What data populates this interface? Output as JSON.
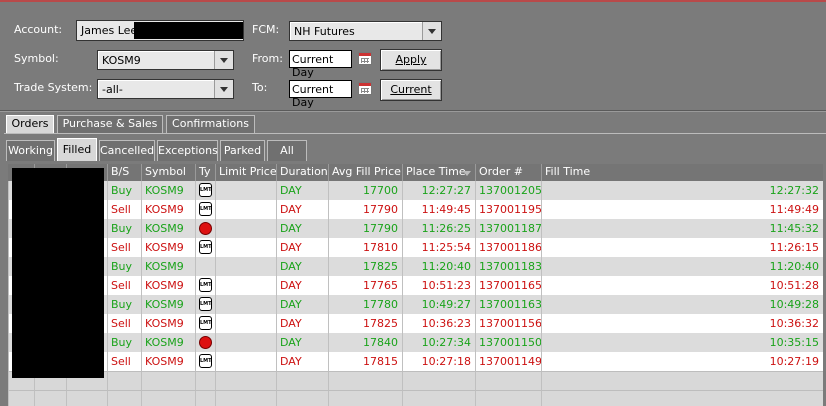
{
  "form": {
    "account_label": "Account:",
    "account_value": "James Lee",
    "fcm_label": "FCM:",
    "fcm_value": "NH Futures",
    "symbol_label": "Symbol:",
    "symbol_value": "KOSM9",
    "from_label": "From:",
    "from_value": "Current Day",
    "apply_label": "Apply",
    "trade_system_label": "Trade System:",
    "trade_system_value": "-all-",
    "to_label": "To:",
    "to_value": "Current Day",
    "current_label": "Current"
  },
  "main_tabs": [
    {
      "label": "Orders",
      "active": true
    },
    {
      "label": "Purchase & Sales",
      "active": false
    },
    {
      "label": "Confirmations",
      "active": false
    }
  ],
  "sub_tabs": [
    {
      "label": "Working",
      "active": false
    },
    {
      "label": "Filled",
      "active": true
    },
    {
      "label": "Cancelled",
      "active": false
    },
    {
      "label": "Exceptions",
      "active": false
    },
    {
      "label": "Parked",
      "active": false
    },
    {
      "label": "All",
      "active": false
    }
  ],
  "columns": {
    "bs": "B/S",
    "symbol": "Symbol",
    "type": "Ty",
    "limit_price": "Limit Price",
    "duration": "Duration",
    "avg_fill": "Avg Fill Price",
    "place_time": "Place Time",
    "order_no": "Order #",
    "fill_time": "Fill Time"
  },
  "rows": [
    {
      "side": "Buy",
      "symbol": "KOSM9",
      "type": "limit",
      "duration": "DAY",
      "avg_fill": "17700",
      "place_time": "12:27:27",
      "order_no": "137001205",
      "fill_time": "12:27:32"
    },
    {
      "side": "Sell",
      "symbol": "KOSM9",
      "type": "limit",
      "duration": "DAY",
      "avg_fill": "17790",
      "place_time": "11:49:45",
      "order_no": "137001195",
      "fill_time": "11:49:49"
    },
    {
      "side": "Buy",
      "symbol": "KOSM9",
      "type": "stop",
      "duration": "DAY",
      "avg_fill": "17790",
      "place_time": "11:26:25",
      "order_no": "137001187",
      "fill_time": "11:45:32"
    },
    {
      "side": "Sell",
      "symbol": "KOSM9",
      "type": "limit",
      "duration": "DAY",
      "avg_fill": "17810",
      "place_time": "11:25:54",
      "order_no": "137001186",
      "fill_time": "11:26:15"
    },
    {
      "side": "Buy",
      "symbol": "KOSM9",
      "type": "none",
      "duration": "DAY",
      "avg_fill": "17825",
      "place_time": "11:20:40",
      "order_no": "137001183",
      "fill_time": "11:20:40"
    },
    {
      "side": "Sell",
      "symbol": "KOSM9",
      "type": "limit",
      "duration": "DAY",
      "avg_fill": "17765",
      "place_time": "10:51:23",
      "order_no": "137001165",
      "fill_time": "10:51:28"
    },
    {
      "side": "Buy",
      "symbol": "KOSM9",
      "type": "limit",
      "duration": "DAY",
      "avg_fill": "17780",
      "place_time": "10:49:27",
      "order_no": "137001163",
      "fill_time": "10:49:28"
    },
    {
      "side": "Sell",
      "symbol": "KOSM9",
      "type": "limit",
      "duration": "DAY",
      "avg_fill": "17825",
      "place_time": "10:36:23",
      "order_no": "137001156",
      "fill_time": "10:36:32"
    },
    {
      "side": "Buy",
      "symbol": "KOSM9",
      "type": "stop",
      "duration": "DAY",
      "avg_fill": "17840",
      "place_time": "10:27:34",
      "order_no": "137001150",
      "fill_time": "10:35:15"
    },
    {
      "side": "Sell",
      "symbol": "KOSM9",
      "type": "limit",
      "duration": "DAY",
      "avg_fill": "17815",
      "place_time": "10:27:18",
      "order_no": "137001149",
      "fill_time": "10:27:19"
    }
  ],
  "colors": {
    "buy": "#1aa31a",
    "sell": "#cc1111",
    "panel_bg": "#7b7b7b"
  }
}
